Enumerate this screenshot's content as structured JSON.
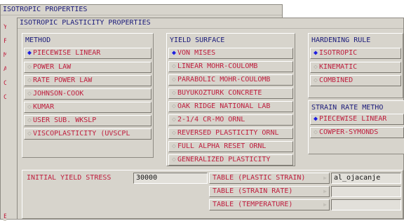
{
  "back_window": {
    "title": "ISOTROPIC PROPERTIES",
    "edge_letters": [
      "Y",
      "F",
      "M",
      "A",
      "C",
      "C",
      "E"
    ]
  },
  "front_window": {
    "title": "ISOTROPIC PLASTICITY PROPERTIES"
  },
  "method": {
    "header": "METHOD",
    "selected": "PIECEWISE LINEAR",
    "options": [
      "PIECEWISE LINEAR",
      "POWER LAW",
      "RATE POWER LAW",
      "JOHNSON-COOK",
      "KUMAR",
      "USER SUB. WKSLP",
      "VISCOPLASTICITY (UVSCPL"
    ]
  },
  "yield_surface": {
    "header": "YIELD SURFACE",
    "selected": "VON MISES",
    "options": [
      "VON MISES",
      "LINEAR MOHR-COULOMB",
      "PARABOLIC MOHR-COULOMB",
      "BUYUKOZTURK CONCRETE",
      "OAK RIDGE NATIONAL LAB",
      "2-1/4 CR-MO ORNL",
      "REVERSED PLASTICITY ORNL",
      "FULL ALPHA RESET ORNL",
      "GENERALIZED PLASTICITY"
    ]
  },
  "hardening_rule": {
    "header": "HARDENING RULE",
    "selected": "ISOTROPIC",
    "options": [
      "ISOTROPIC",
      "KINEMATIC",
      "COMBINED"
    ]
  },
  "strain_rate_method": {
    "header": "STRAIN RATE METHO",
    "selected": "PIECEWISE LINEAR",
    "options": [
      "PIECEWISE LINEAR",
      "COWPER-SYMONDS"
    ]
  },
  "initial_yield": {
    "label": "INITIAL YIELD STRESS",
    "value": "30000"
  },
  "tables": [
    {
      "label": "TABLE (PLASTIC STRAIN)",
      "value": "al_ojacanje"
    },
    {
      "label": "TABLE (STRAIN RATE)",
      "value": ""
    },
    {
      "label": "TABLE (TEMPERATURE)",
      "value": ""
    }
  ],
  "colors": {
    "panel": "#d7d4cc",
    "text_red": "#bf1e3e",
    "text_blue": "#1a1a7a",
    "selected_mark": "#1d1de0"
  },
  "icons": {
    "radio_selected": "diamond-filled",
    "radio_unselected": "diamond-outline",
    "table_arrow": "triangle-right"
  }
}
